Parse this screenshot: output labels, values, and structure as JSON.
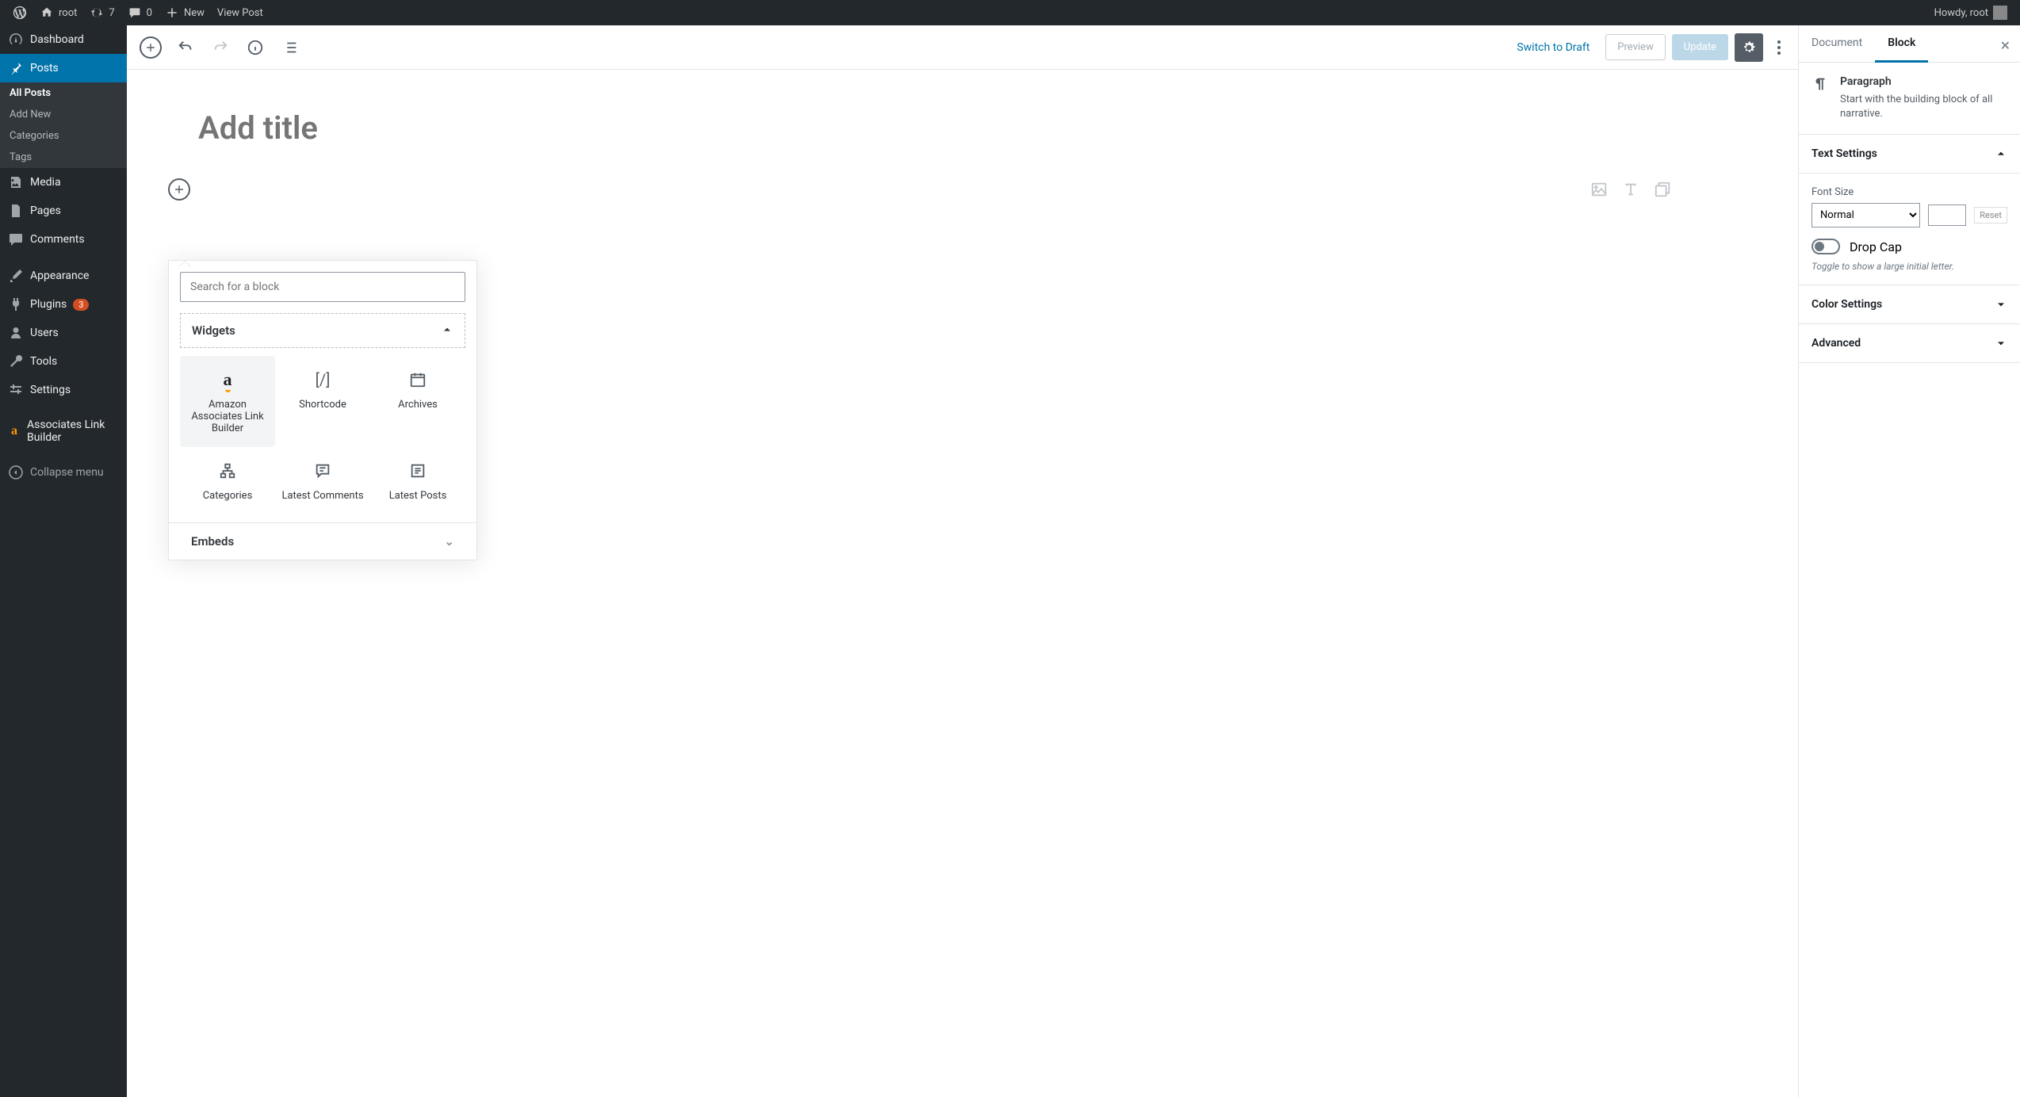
{
  "adminbar": {
    "site_name": "root",
    "updates_count": "7",
    "comments_count": "0",
    "new_label": "New",
    "view_post": "View Post",
    "howdy": "Howdy, root"
  },
  "sidebar": {
    "dashboard": "Dashboard",
    "posts": "Posts",
    "posts_sub": {
      "all": "All Posts",
      "add": "Add New",
      "cats": "Categories",
      "tags": "Tags"
    },
    "media": "Media",
    "pages": "Pages",
    "comments": "Comments",
    "appearance": "Appearance",
    "plugins": "Plugins",
    "plugins_count": "3",
    "users": "Users",
    "tools": "Tools",
    "settings": "Settings",
    "alb": "Associates Link Builder",
    "collapse": "Collapse menu"
  },
  "toolbar": {
    "switch_draft": "Switch to Draft",
    "preview": "Preview",
    "update": "Update"
  },
  "editor": {
    "title_placeholder": "Add title"
  },
  "inserter": {
    "search_placeholder": "Search for a block",
    "panel_widgets": "Widgets",
    "panel_embeds": "Embeds",
    "items": {
      "amazon": "Amazon Associates Link Builder",
      "shortcode": "Shortcode",
      "archives": "Archives",
      "categories": "Categories",
      "latest_comments": "Latest Comments",
      "latest_posts": "Latest Posts"
    }
  },
  "settings": {
    "tab_document": "Document",
    "tab_block": "Block",
    "block_title": "Paragraph",
    "block_desc": "Start with the building block of all narrative.",
    "text_settings": "Text Settings",
    "font_size": "Font Size",
    "font_size_value": "Normal",
    "reset": "Reset",
    "drop_cap": "Drop Cap",
    "drop_cap_help": "Toggle to show a large initial letter.",
    "color_settings": "Color Settings",
    "advanced": "Advanced"
  }
}
